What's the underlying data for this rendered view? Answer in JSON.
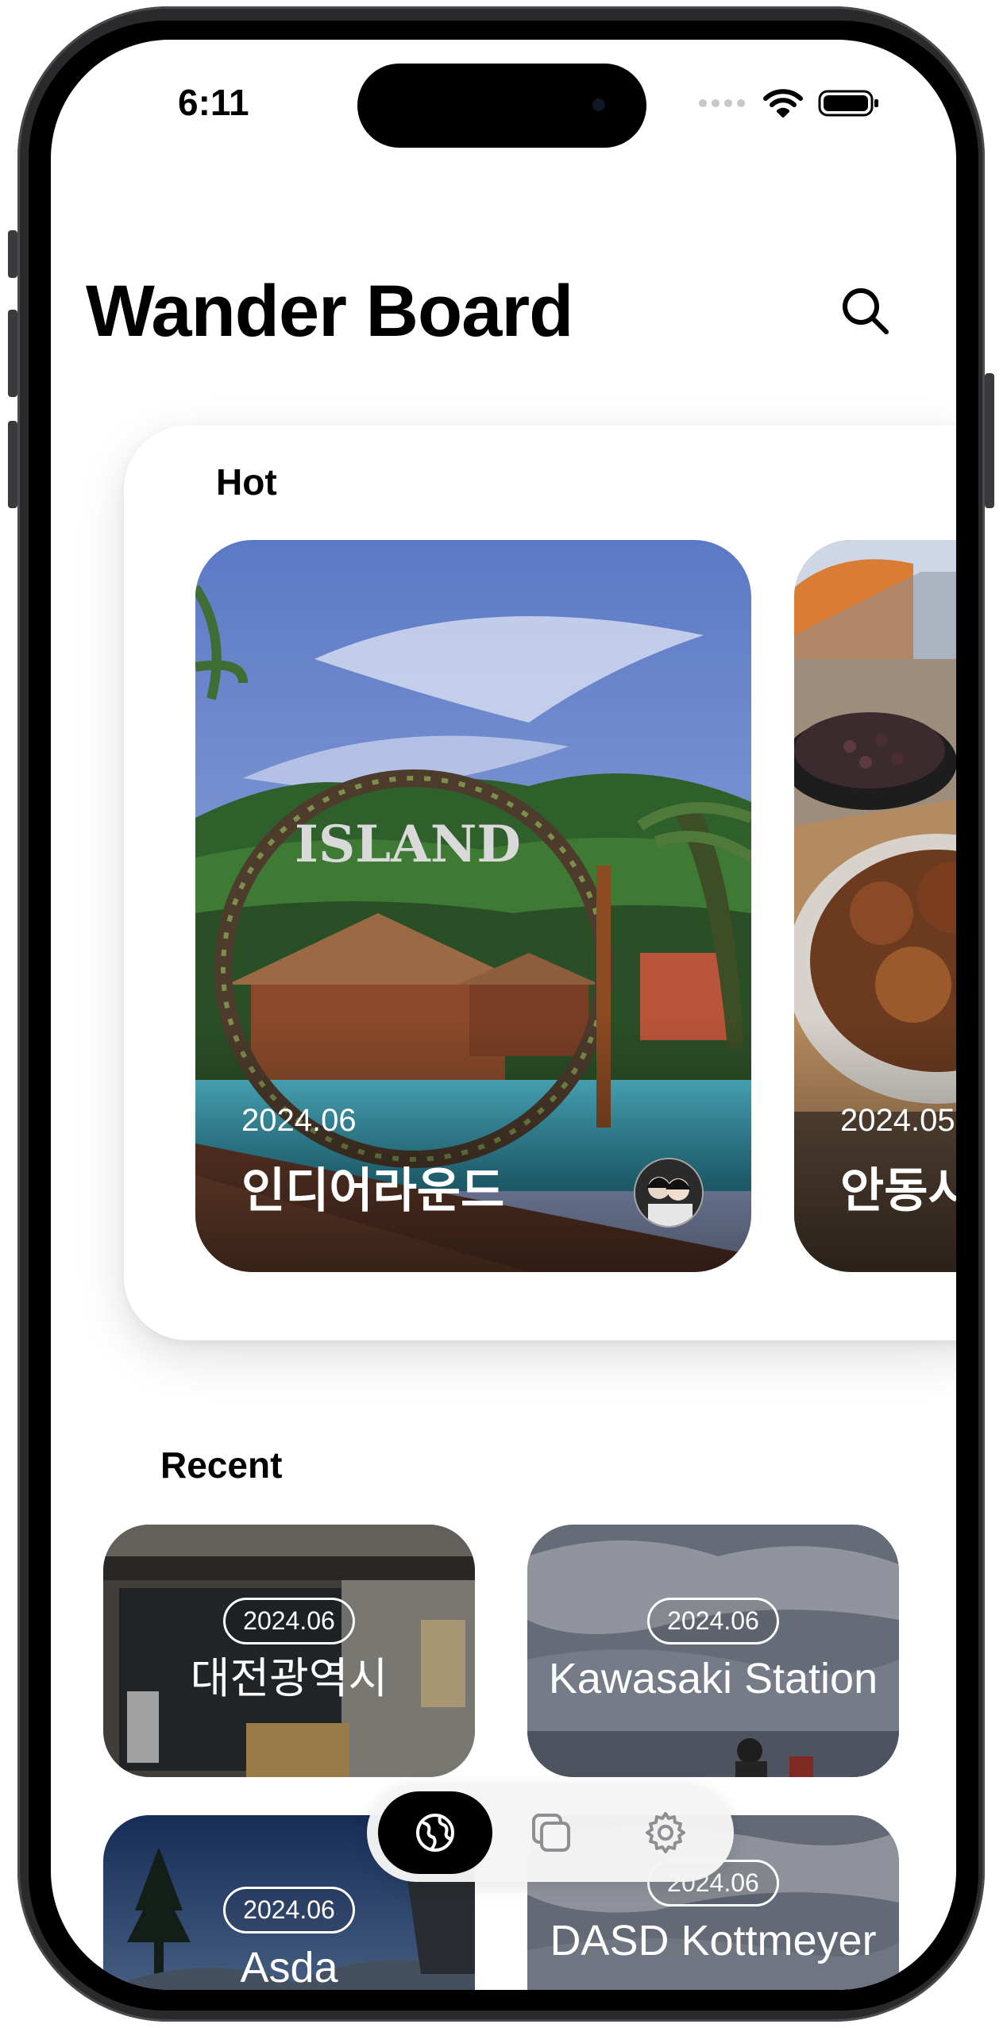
{
  "status_bar": {
    "time": "6:11"
  },
  "header": {
    "title": "Wander Board",
    "search_icon": "search-icon"
  },
  "hot": {
    "label": "Hot",
    "cards": [
      {
        "date": "2024.06",
        "title": "인디어라운드",
        "sign_text": "ISLAND"
      },
      {
        "date": "2024.05",
        "title": "안동시"
      }
    ]
  },
  "recent": {
    "label": "Recent",
    "cards": [
      {
        "date": "2024.06",
        "title": "대전광역시"
      },
      {
        "date": "2024.06",
        "title": "Kawasaki Station"
      },
      {
        "date": "2024.06",
        "title": "Asda"
      },
      {
        "date": "2024.06",
        "title": "DASD Kottmeyer"
      }
    ]
  },
  "tabbar": {
    "tabs": [
      {
        "icon": "globe-icon",
        "active": true
      },
      {
        "icon": "stack-icon",
        "active": false
      },
      {
        "icon": "gear-icon",
        "active": false
      }
    ]
  },
  "colors": {
    "background": "#ffffff",
    "text": "#000000",
    "active_tab": "#000000"
  }
}
